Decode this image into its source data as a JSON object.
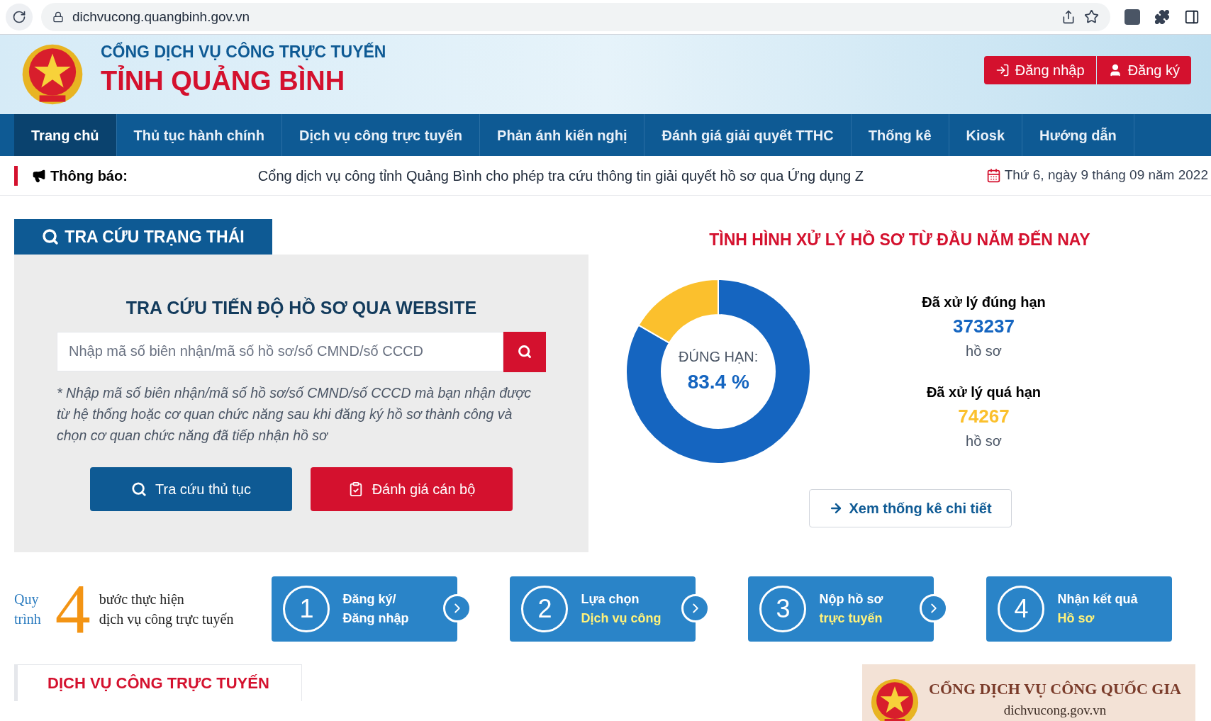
{
  "browser": {
    "url": "dichvucong.quangbinh.gov.vn"
  },
  "header": {
    "subtitle": "CỔNG DỊCH VỤ CÔNG TRỰC TUYẾN",
    "title": "TỈNH QUẢNG BÌNH",
    "buttons": [
      {
        "label": "Đăng nhập",
        "kind": "login"
      },
      {
        "label": "Đăng ký",
        "kind": "register"
      }
    ]
  },
  "nav": [
    {
      "label": "Trang chủ",
      "selected": true
    },
    {
      "label": "Thủ tục hành chính",
      "selected": false
    },
    {
      "label": "Dịch vụ công trực tuyến",
      "selected": false
    },
    {
      "label": "Phản ánh kiến nghị",
      "selected": false
    },
    {
      "label": "Đánh giá giải quyết TTHC",
      "selected": false
    },
    {
      "label": "Thống kê",
      "selected": false
    },
    {
      "label": "Kiosk",
      "selected": false
    },
    {
      "label": "Hướng dẫn",
      "selected": false
    }
  ],
  "notice": {
    "label": "Thông báo:",
    "text": "Cổng dịch vụ công tỉnh Quảng Bình cho phép tra cứu thông tin giải quyết hồ sơ qua Ứng dụng Z",
    "date": "Thứ 6, ngày 9 tháng 09 năm 2022"
  },
  "lookup": {
    "tab_title": "TRA CỨU TRẠNG THÁI",
    "heading": "TRA CỨU TIẾN ĐỘ HỒ SƠ QUA WEBSITE",
    "placeholder": "Nhập mã số biên nhận/mã số hồ sơ/số CMND/số CCCD",
    "note": "* Nhập mã số biên nhận/mã số hồ sơ/số CMND/số CCCD mà bạn nhận được từ hệ thống hoặc cơ quan chức năng sau khi đăng ký hồ sơ thành công và chọn cơ quan chức năng đã tiếp nhận hồ sơ",
    "buttons": [
      {
        "label": "Tra cứu thủ tục",
        "kind": "search"
      },
      {
        "label": "Đánh giá cán bộ",
        "kind": "rate"
      }
    ]
  },
  "stats": {
    "title": "TÌNH HÌNH XỬ LÝ HỒ SƠ TỪ ĐẦU NĂM ĐẾN NAY",
    "chart_data": {
      "type": "donut",
      "values": [
        83.4,
        16.6
      ]
    },
    "center_label": "ĐÚNG HẠN:",
    "center_value": "83.4 %",
    "items": [
      {
        "label": "Đã xử lý đúng hạn",
        "value": "373237",
        "unit": "hồ sơ",
        "color": "#1565c0"
      },
      {
        "label": "Đã xử lý quá hạn",
        "value": "74267",
        "unit": "hồ sơ",
        "color": "#fbc02d"
      }
    ],
    "link": "Xem thống kê chi tiết"
  },
  "process": {
    "word_top": "Quy",
    "word_bottom": "trình",
    "number": "4",
    "line1": "bước thực hiện",
    "line2": "dịch vụ công trực tuyến",
    "steps": [
      {
        "number": "1",
        "line1": "Đăng ký/",
        "line2": "Đăng nhập"
      },
      {
        "number": "2",
        "line1": "Lựa chọn",
        "line2": "Dịch vụ công"
      },
      {
        "number": "3",
        "line1": "Nộp hồ sơ",
        "line2": "trực tuyến"
      },
      {
        "number": "4",
        "line1": "Nhận kết quả",
        "line2": "Hồ sơ"
      }
    ]
  },
  "bottom": {
    "section_title": "DỊCH VỤ CÔNG TRỰC TUYẾN",
    "banner_title": "CỔNG DỊCH VỤ CÔNG QUỐC GIA",
    "banner_url": "dichvucong.gov.vn"
  }
}
